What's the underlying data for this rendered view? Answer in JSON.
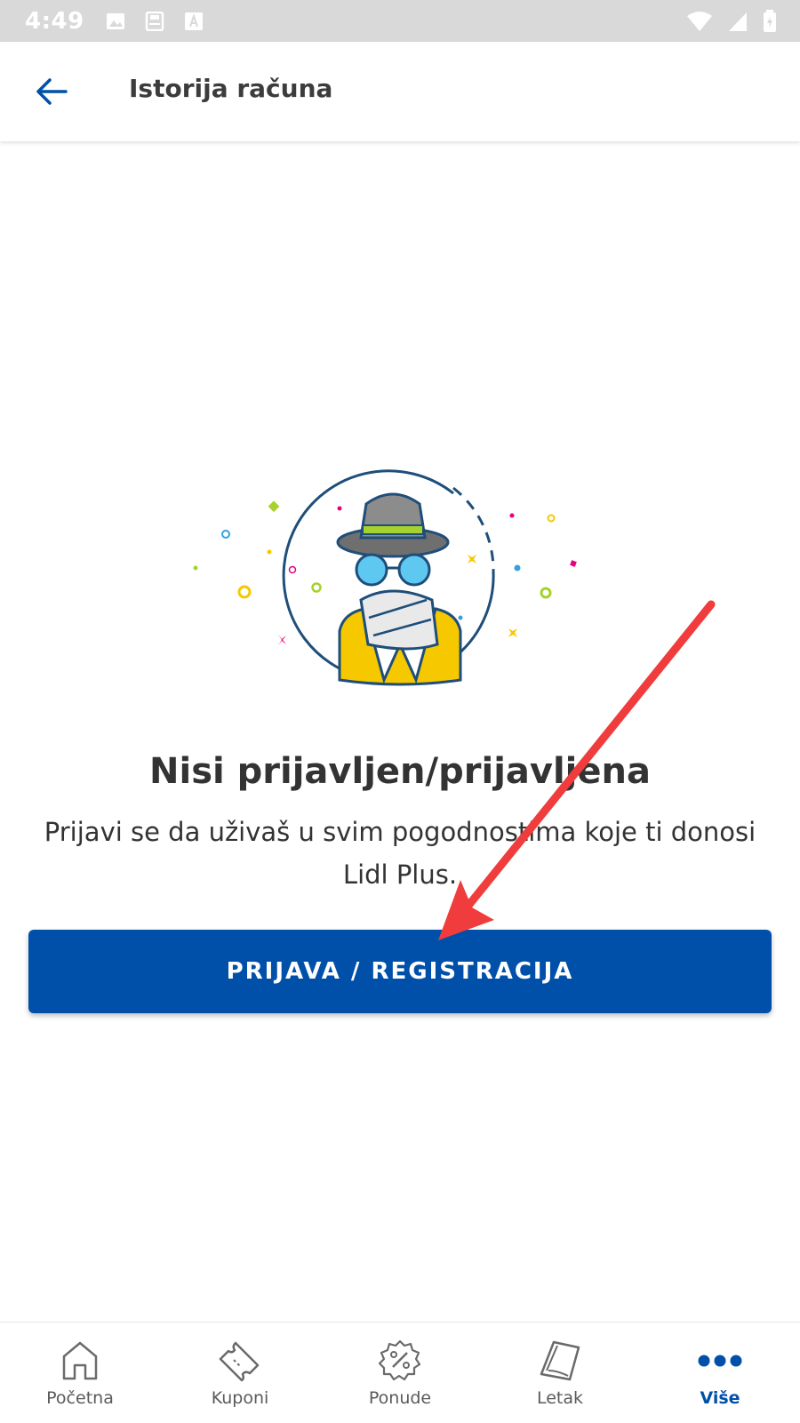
{
  "status_bar": {
    "time": "4:49"
  },
  "app_bar": {
    "title": "Istorija računa",
    "back_icon": "arrow-left-icon"
  },
  "main": {
    "headline": "Nisi prijavljen/prijavljena",
    "subtext": "Prijavi se da uživaš u svim pogodnostima koje ti donosi Lidl Plus.",
    "button_label": "PRIJAVA / REGISTRACIJA"
  },
  "bottom_nav": {
    "items": [
      {
        "label": "Početna",
        "icon": "home-icon",
        "active": false
      },
      {
        "label": "Kuponi",
        "icon": "coupon-icon",
        "active": false
      },
      {
        "label": "Ponude",
        "icon": "discount-badge-icon",
        "active": false
      },
      {
        "label": "Letak",
        "icon": "leaflet-icon",
        "active": false
      },
      {
        "label": "Više",
        "icon": "more-dots-icon",
        "active": true
      }
    ]
  },
  "colors": {
    "primary": "#0050aa",
    "arrow": "#f03c3c",
    "text": "#333333"
  }
}
